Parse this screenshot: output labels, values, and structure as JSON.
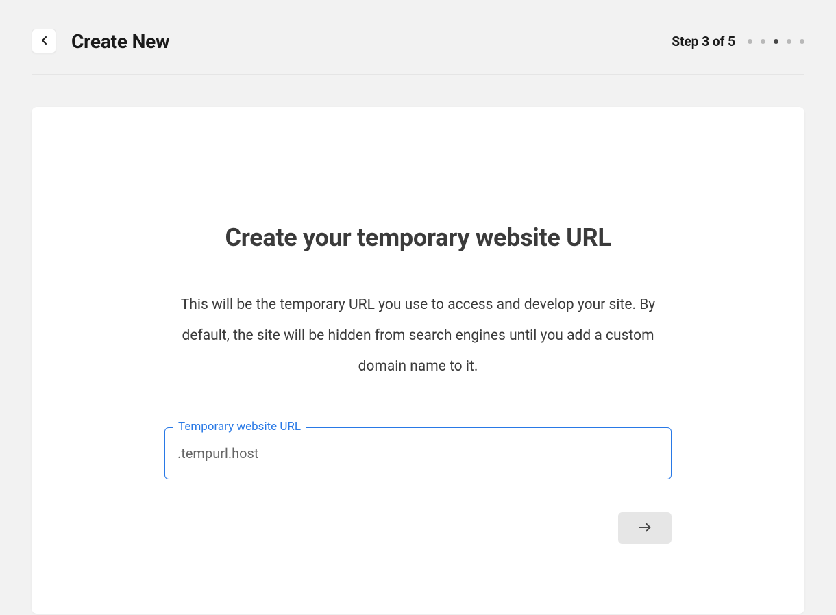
{
  "header": {
    "title": "Create New",
    "step_label": "Step 3 of 5",
    "current_step": 3,
    "total_steps": 5
  },
  "main": {
    "heading": "Create your temporary website URL",
    "description": "This will be the temporary URL you use to access and develop your site. By default, the site will be hidden from search engines until you add a custom domain name to it.",
    "input_label": "Temporary website URL",
    "input_value": ".tempurl.host"
  }
}
